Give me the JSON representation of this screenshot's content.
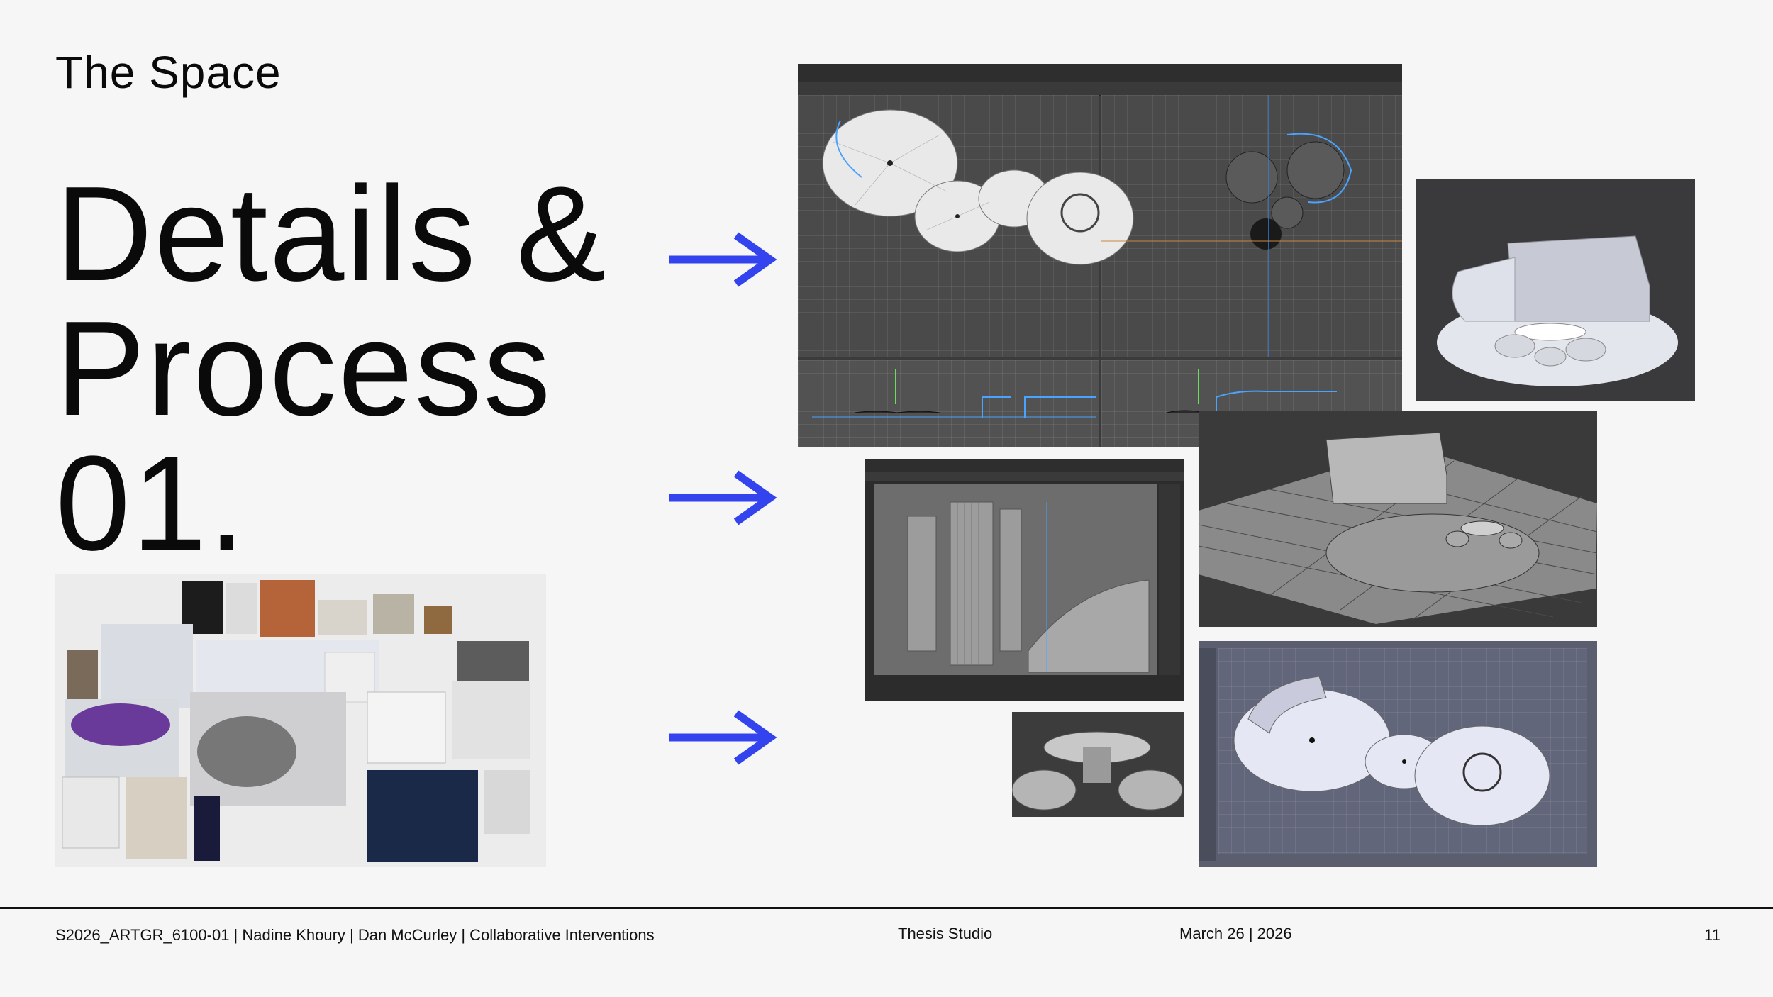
{
  "slide": {
    "section_title": "The Space",
    "title_lines": [
      "Details &",
      "Process",
      "01."
    ],
    "accent_color": "#3344ee"
  },
  "footer": {
    "course": "S2026_ARTGR_6100-01 | Nadine Khoury | Dan McCurley | Collaborative Interventions",
    "studio": "Thesis Studio",
    "date": "March 26 | 2026",
    "page_number": "11"
  },
  "images": [
    {
      "id": "c4d-quad-view",
      "kind": "photo-of-screen",
      "subject": "four-view 3D modeling viewport of circular platforms"
    },
    {
      "id": "render-room-top",
      "kind": "3d-render",
      "subject": "room with seating pods"
    },
    {
      "id": "render-room-grid",
      "kind": "3d-render",
      "subject": "room on grid floor"
    },
    {
      "id": "closeup-curtain",
      "kind": "photo-of-screen",
      "subject": "close-up of wall panels"
    },
    {
      "id": "table-pods",
      "kind": "3d-render",
      "subject": "table with seat pods"
    },
    {
      "id": "perspective-platforms",
      "kind": "photo-of-screen",
      "subject": "perspective view of platforms"
    },
    {
      "id": "moodboard",
      "kind": "collage",
      "subject": "reference images moodboard"
    }
  ]
}
